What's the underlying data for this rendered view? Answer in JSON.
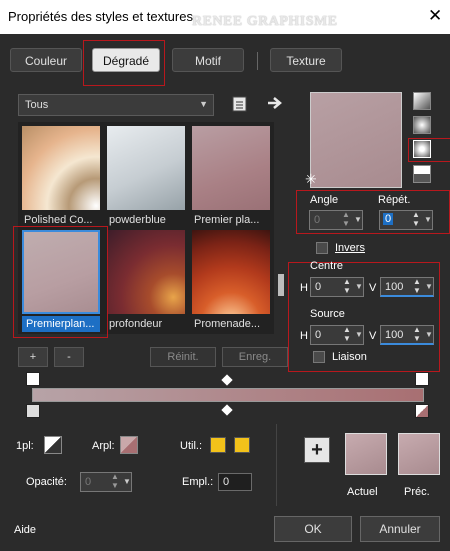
{
  "window": {
    "title": "Propriétés des styles et textures",
    "watermark": "RENEE GRAPHISME",
    "close": "✕"
  },
  "tabs": [
    {
      "label": "Couleur",
      "selected": false
    },
    {
      "label": "Dégradé",
      "selected": true
    },
    {
      "label": "Motif",
      "selected": false
    },
    {
      "label": "Texture",
      "selected": false
    }
  ],
  "library": {
    "category": "Tous",
    "items": [
      {
        "name": "Polished Co...",
        "selected": false
      },
      {
        "name": "powderblue",
        "selected": false
      },
      {
        "name": "Premier pla...",
        "selected": false
      },
      {
        "name": "Premierplan...",
        "selected": true
      },
      {
        "name": "profondeur",
        "selected": false
      },
      {
        "name": "Promenade...",
        "selected": false
      }
    ],
    "add_label": "+",
    "remove_label": "-",
    "reset_label": "Réinit.",
    "save_label": "Enreg."
  },
  "gradient": {
    "angle_label": "Angle",
    "angle_value": "0",
    "repeat_label": "Répét.",
    "repeat_value": "0",
    "invert_label": "Invers",
    "center_label": "Centre",
    "center_h_label": "H",
    "center_h": "0",
    "center_v_label": "V",
    "center_v": "100",
    "source_label": "Source",
    "source_h_label": "H",
    "source_h": "0",
    "source_v_label": "V",
    "source_v": "100",
    "link_label": "Liaison",
    "colors": {
      "start": "#b7a3a7",
      "end": "#a86f72"
    }
  },
  "stops": {
    "fg_label": "1pl:",
    "bg_label": "Arpl:",
    "user_label": "Util.:",
    "opacity_label": "Opacité:",
    "opacity_value": "0",
    "location_label": "Empl.:",
    "location_value": "0",
    "user_colors": [
      "#f2c21a",
      "#f2c21a"
    ]
  },
  "swatches": {
    "add_label": "+",
    "current_label": "Actuel",
    "previous_label": "Préc."
  },
  "footer": {
    "help": "Aide",
    "ok": "OK",
    "cancel": "Annuler"
  }
}
